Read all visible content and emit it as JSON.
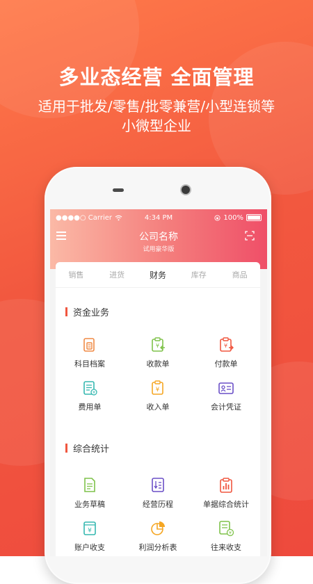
{
  "promo": {
    "headline": "多业态经营 全面管理",
    "line1": "适用于批发/零售/批零兼营/小型连锁等",
    "line2": "小微型企业"
  },
  "status_bar": {
    "carrier": "●●●●○ Carrier",
    "time": "4:34 PM",
    "battery": "100%"
  },
  "app": {
    "title": "公司名称",
    "subtitle": "试用豪华版"
  },
  "tabs": [
    "销售",
    "进货",
    "财务",
    "库存",
    "商品"
  ],
  "active_tab": "财务",
  "sections": [
    {
      "title": "资金业务",
      "items": [
        {
          "label": "科目档案",
          "icon": "folder-icon",
          "color": "#f08a45"
        },
        {
          "label": "收款单",
          "icon": "receipt-in-icon",
          "color": "#7fc24a"
        },
        {
          "label": "付款单",
          "icon": "receipt-out-icon",
          "color": "#f0563f"
        },
        {
          "label": "费用单",
          "icon": "expense-doc-icon",
          "color": "#35b8b0"
        },
        {
          "label": "收入单",
          "icon": "income-doc-icon",
          "color": "#f5a623"
        },
        {
          "label": "会计凭证",
          "icon": "voucher-card-icon",
          "color": "#6a4fc7"
        }
      ]
    },
    {
      "title": "综合统计",
      "items": [
        {
          "label": "业务草稿",
          "icon": "draft-doc-icon",
          "color": "#7fc24a"
        },
        {
          "label": "经营历程",
          "icon": "history-doc-icon",
          "color": "#6a4fc7"
        },
        {
          "label": "单据综合统计",
          "icon": "bar-stats-icon",
          "color": "#f0563f"
        },
        {
          "label": "账户收支",
          "icon": "account-yen-icon",
          "color": "#35b8b0"
        },
        {
          "label": "利润分析表",
          "icon": "pie-chart-icon",
          "color": "#f5a623"
        },
        {
          "label": "往来收支",
          "icon": "exchange-doc-icon",
          "color": "#7fc24a"
        }
      ]
    }
  ]
}
